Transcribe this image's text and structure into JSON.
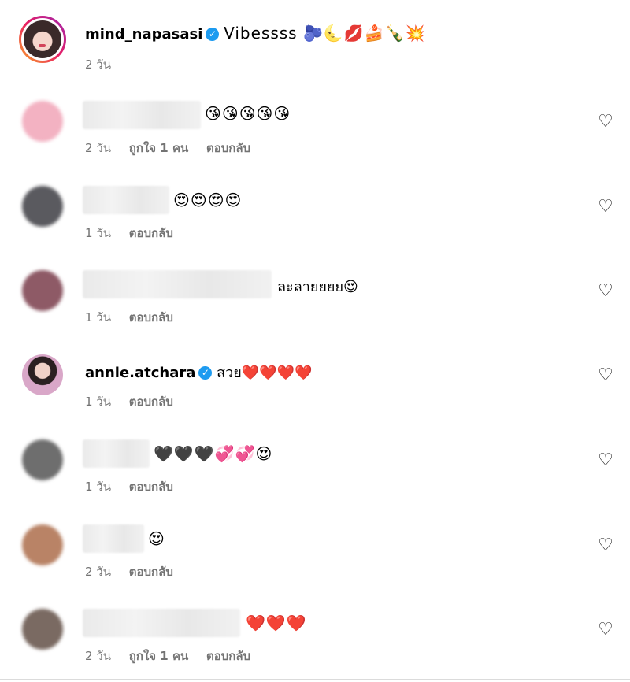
{
  "caption": {
    "username": "mind_napasasi",
    "text": "Vibessss 🫐🌜💋🍰🍾💥",
    "time": "2 วัน"
  },
  "comments": [
    {
      "text": "😘😘😘😘😘",
      "time": "2 วัน",
      "likes": "ถูกใจ 1 คน",
      "reply": "ตอบกลับ"
    },
    {
      "text": "😍😍😍😍",
      "time": "1 วัน",
      "likes": "",
      "reply": "ตอบกลับ"
    },
    {
      "text": "ละลายยยย😍",
      "time": "1 วัน",
      "likes": "",
      "reply": "ตอบกลับ"
    },
    {
      "username": "annie.atchara",
      "text": "สวย❤️❤️❤️❤️",
      "time": "1 วัน",
      "likes": "",
      "reply": "ตอบกลับ"
    },
    {
      "text": "🖤🖤🖤💞💞😍",
      "time": "1 วัน",
      "likes": "",
      "reply": "ตอบกลับ"
    },
    {
      "text": "😍",
      "time": "2 วัน",
      "likes": "",
      "reply": "ตอบกลับ"
    },
    {
      "text": "❤️❤️❤️",
      "time": "2 วัน",
      "likes": "ถูกใจ 1 คน",
      "reply": "ตอบกลับ"
    }
  ],
  "icons": {
    "like": "heart-outline-icon",
    "verified": "verified-badge-icon"
  },
  "colors": {
    "verified": "#1d9bf0",
    "meta": "#737373"
  }
}
